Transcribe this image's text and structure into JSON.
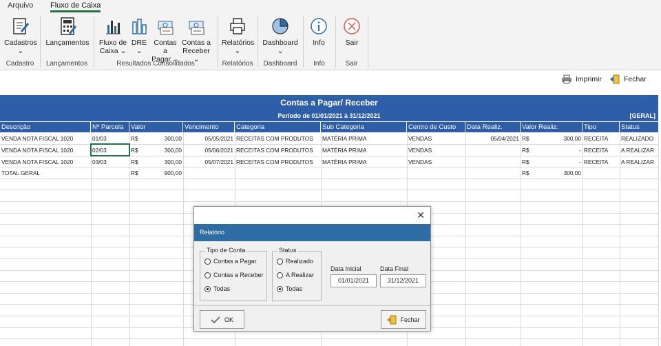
{
  "tabs": [
    "Arquivo",
    "Fluxo de Caixa"
  ],
  "ribbon": {
    "buttons": [
      {
        "line1": "Cadastros",
        "line2": "⌄",
        "icon": "form-edit-icon"
      },
      {
        "line1": "Lançamentos",
        "line2": "",
        "icon": "calculator-icon"
      },
      {
        "line1": "Fluxo de",
        "line2": "Caixa ⌄",
        "icon": "column-chart-icon"
      },
      {
        "line1": "DRE",
        "line2": "⌄",
        "icon": "bar-chart-icon"
      },
      {
        "line1": "Contas a",
        "line2": "Pagar ⌄",
        "icon": "money-pay-icon"
      },
      {
        "line1": "Contas a",
        "line2": "Receber ⌄",
        "icon": "money-receive-icon"
      },
      {
        "line1": "Relatórios",
        "line2": "⌄",
        "icon": "printer-icon"
      },
      {
        "line1": "Dashboard",
        "line2": "⌄",
        "icon": "pie-chart-icon"
      },
      {
        "line1": "Info",
        "line2": "",
        "icon": "info-icon"
      },
      {
        "line1": "Sair",
        "line2": "",
        "icon": "exit-icon"
      }
    ],
    "groups": [
      "Cadastro",
      "Lançamentos",
      "Resultados Consolidados",
      "Relatórios",
      "Dashboard",
      "Info",
      "Sair"
    ]
  },
  "actions": {
    "imprimir": "Imprimir",
    "fechar": "Fechar"
  },
  "report": {
    "title": "Contas a Pagar/ Receber",
    "period": "Período de 01/01/2021 à 31/12/2021",
    "filter_tag": "[GERAL]",
    "columns": [
      "Descrição",
      "Nº Parcela",
      "Valor",
      "Vencimento",
      "Categoria",
      "Sub Categoria",
      "Centro de Custo",
      "Data Realiz.",
      "Valor Realiz.",
      "Tipo",
      "Status"
    ],
    "rows": [
      {
        "descricao": "VENDA NOTA FISCAL 1020",
        "parcela": "01/03",
        "cur": "R$",
        "valor": "300,00",
        "vencimento": "05/05/2021",
        "categoria": "RECEITAS COM PRODUTOS",
        "subcategoria": "MATÉRIA PRIMA",
        "centro": "VENDAS",
        "data_realiz": "05/04/2021",
        "cur2": "R$",
        "valor_realiz": "300,00",
        "tipo": "RECEITA",
        "status": "REALIZADO"
      },
      {
        "descricao": "VENDA NOTA FISCAL 1020",
        "parcela": "02/03",
        "cur": "R$",
        "valor": "300,00",
        "vencimento": "05/06/2021",
        "categoria": "RECEITAS COM PRODUTOS",
        "subcategoria": "MATÉRIA PRIMA",
        "centro": "VENDAS",
        "data_realiz": "",
        "cur2": "R$",
        "valor_realiz": "-",
        "tipo": "RECEITA",
        "status": "A REALIZAR"
      },
      {
        "descricao": "VENDA NOTA FISCAL 1020",
        "parcela": "03/03",
        "cur": "R$",
        "valor": "300,00",
        "vencimento": "05/07/2021",
        "categoria": "RECEITAS COM PRODUTOS",
        "subcategoria": "MATÉRIA PRIMA",
        "centro": "VENDAS",
        "data_realiz": "",
        "cur2": "R$",
        "valor_realiz": "-",
        "tipo": "RECEITA",
        "status": "A REALIZAR"
      }
    ],
    "total": {
      "label": "TOTAL GERAL",
      "cur": "R$",
      "valor": "900,00",
      "cur2": "R$",
      "valor_realiz": "300,00"
    }
  },
  "dialog": {
    "title": "Relatório",
    "tipo_legend": "Tipo de Conta",
    "tipo_options": [
      {
        "label": "Contas a Pagar",
        "selected": false
      },
      {
        "label": "Contas a Receber",
        "selected": false
      },
      {
        "label": "Todas",
        "selected": true
      }
    ],
    "status_legend": "Status",
    "status_options": [
      {
        "label": "Realizado",
        "selected": false
      },
      {
        "label": "A Realizar",
        "selected": false
      },
      {
        "label": "Todas",
        "selected": true
      }
    ],
    "data_inicial_label": "Data Inicial",
    "data_inicial": "01/01/2021",
    "data_final_label": "Data Final",
    "data_final": "31/12/2021",
    "ok_label": "OK",
    "fechar_label": "Fechar"
  },
  "colors": {
    "header_blue": "#2e5ea7",
    "dialog_title_blue": "#2e6da4",
    "excel_green": "#217346"
  }
}
